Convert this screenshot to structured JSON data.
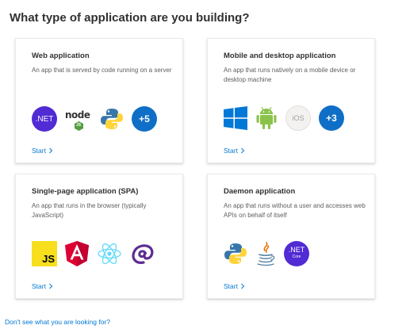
{
  "page": {
    "heading": "What type of application are you building?",
    "footer_link": "Don't see what you are looking for?"
  },
  "colors": {
    "link": "#0078d4",
    "plus_badge": "#0f6fc6",
    "dotnet_purple": "#512bd4",
    "node_green": "#539e43",
    "android_green": "#8bc34a",
    "windows_blue": "#0078d7",
    "js_yellow": "#f7df1e",
    "angular_red": "#dd0031",
    "react_blue": "#61dafb",
    "blazor_purple": "#5c2d91",
    "java_red": "#e76f00",
    "python_blue": "#3776ab",
    "python_yellow": "#ffd43b"
  },
  "cards": [
    {
      "title": "Web application",
      "description": "An app that is served by code running on a server",
      "start": "Start",
      "icons": [
        {
          "name": "dotnet-icon",
          "label": ".NET"
        },
        {
          "name": "nodejs-icon",
          "label": "node",
          "sublabel": "JS"
        },
        {
          "name": "python-icon"
        },
        {
          "name": "more-badge",
          "label": "+5"
        }
      ]
    },
    {
      "title": "Mobile and desktop application",
      "description": "An app that runs natively on a mobile device or desktop machine",
      "start": "Start",
      "icons": [
        {
          "name": "windows-icon"
        },
        {
          "name": "android-icon"
        },
        {
          "name": "ios-icon",
          "label": "iOS"
        },
        {
          "name": "more-badge",
          "label": "+3"
        }
      ]
    },
    {
      "title": "Single-page application (SPA)",
      "description": "An app that runs in the browser (typically JavaScript)",
      "start": "Start",
      "icons": [
        {
          "name": "javascript-icon",
          "label": "JS"
        },
        {
          "name": "angular-icon"
        },
        {
          "name": "react-icon"
        },
        {
          "name": "blazor-icon"
        }
      ]
    },
    {
      "title": "Daemon application",
      "description": "An app that runs without a user and accesses web APIs on behalf of itself",
      "start": "Start",
      "icons": [
        {
          "name": "python-icon"
        },
        {
          "name": "java-icon"
        },
        {
          "name": "dotnet-core-icon",
          "label": ".NET",
          "sublabel": "Core"
        }
      ]
    }
  ]
}
